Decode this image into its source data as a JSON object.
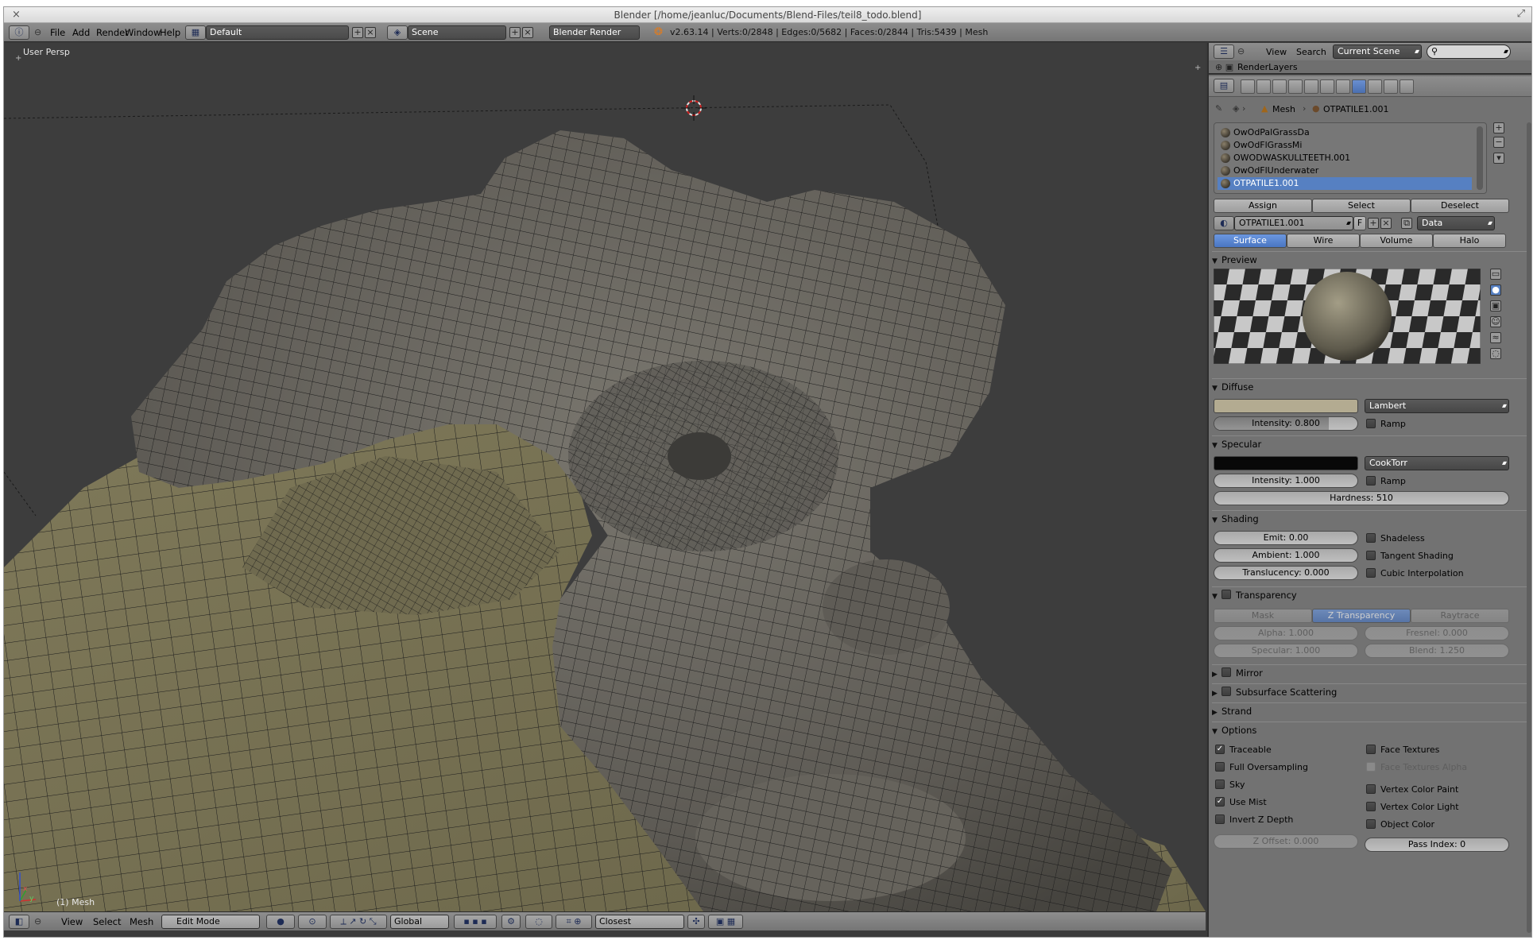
{
  "window": {
    "title": "Blender [/home/jeanluc/Documents/Blend-Files/teil8_todo.blend]",
    "close_glyph": "×",
    "max_glyph": "⤢"
  },
  "info_header": {
    "menus": [
      "File",
      "Add",
      "Render",
      "Window",
      "Help"
    ],
    "layout": "Default",
    "scene": "Scene",
    "engine": "Blender Render",
    "stats": "v2.63.14 | Verts:0/2848 | Edges:0/5682 | Faces:0/2844 | Tris:5439 | Mesh"
  },
  "viewport": {
    "view_name": "User Persp",
    "object_label": "(1) Mesh",
    "axis_x": "x",
    "axis_y": "y"
  },
  "viewport_header": {
    "menus": [
      "View",
      "Select",
      "Mesh"
    ],
    "mode": "Edit Mode",
    "orientation": "Global",
    "snap": "Closest"
  },
  "outliner": {
    "view": "View",
    "search": "Search",
    "filter": "Current Scene",
    "row": "RenderLayers"
  },
  "properties": {
    "breadcrumb_mesh": "Mesh",
    "breadcrumb_material": "OTPATILE1.001",
    "materials": [
      {
        "name": "OwOdPalGrassDa",
        "selected": false
      },
      {
        "name": "OwOdFlGrassMi",
        "selected": false
      },
      {
        "name": "OWODWASKULLTEETH.001",
        "selected": false
      },
      {
        "name": "OwOdFlUnderwater",
        "selected": false
      },
      {
        "name": "OTPATILE1.001",
        "selected": true
      }
    ],
    "assign": "Assign",
    "select": "Select",
    "deselect": "Deselect",
    "material_name": "OTPATILE1.001",
    "fake_user": "F",
    "link": "Data",
    "tabs": [
      "Surface",
      "Wire",
      "Volume",
      "Halo"
    ],
    "preview": "Preview",
    "diffuse": {
      "header": "Diffuse",
      "color": "#b3ab91",
      "shader": "Lambert",
      "intensity": "Intensity: 0.800",
      "intensity_value": 0.8,
      "ramp": "Ramp"
    },
    "specular": {
      "header": "Specular",
      "color": "#080808",
      "shader": "CookTorr",
      "intensity": "Intensity: 1.000",
      "ramp": "Ramp",
      "hardness": "Hardness: 510"
    },
    "shading": {
      "header": "Shading",
      "emit": "Emit: 0.00",
      "ambient": "Ambient: 1.000",
      "translucency": "Translucency: 0.000",
      "shadeless": "Shadeless",
      "tangent": "Tangent Shading",
      "cubic": "Cubic Interpolation"
    },
    "transparency": {
      "header": "Transparency",
      "modes": [
        "Mask",
        "Z Transparency",
        "Raytrace"
      ],
      "alpha": "Alpha: 1.000",
      "fresnel": "Fresnel: 0.000",
      "specular": "Specular: 1.000",
      "blend": "Blend: 1.250"
    },
    "mirror": "Mirror",
    "sss": "Subsurface Scattering",
    "strand": "Strand",
    "options": {
      "header": "Options",
      "left": [
        {
          "label": "Traceable",
          "checked": true
        },
        {
          "label": "Full Oversampling",
          "checked": false
        },
        {
          "label": "Sky",
          "checked": false
        },
        {
          "label": "Use Mist",
          "checked": true
        },
        {
          "label": "Invert Z Depth",
          "checked": false
        }
      ],
      "right": [
        {
          "label": "Face Textures",
          "checked": false
        },
        {
          "label": "Face Textures Alpha",
          "checked": false
        },
        {
          "label": "Vertex Color Paint",
          "checked": false
        },
        {
          "label": "Vertex Color Light",
          "checked": false
        },
        {
          "label": "Object Color",
          "checked": false
        }
      ],
      "zoffset": "Z Offset: 0.000",
      "pass_index": "Pass Index: 0"
    }
  }
}
